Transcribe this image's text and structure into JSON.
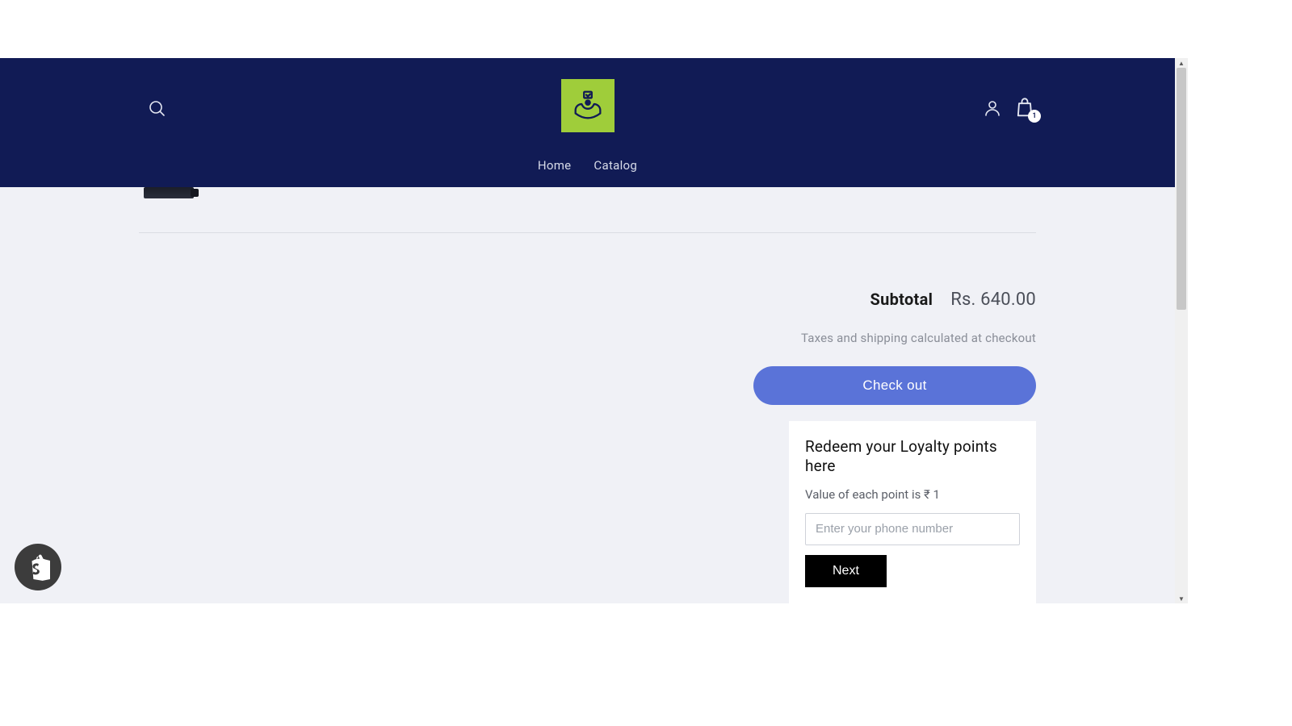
{
  "header": {
    "nav": {
      "home": "Home",
      "catalog": "Catalog"
    },
    "cart_count": "1"
  },
  "cart": {
    "subtotal_label": "Subtotal",
    "subtotal_amount": "Rs. 640.00",
    "tax_note": "Taxes and shipping calculated at checkout",
    "checkout_label": "Check out"
  },
  "loyalty": {
    "title": "Redeem your Loyalty points here",
    "subtitle": "Value of each point is ₹ 1",
    "phone_placeholder": "Enter your phone number",
    "next_label": "Next"
  }
}
